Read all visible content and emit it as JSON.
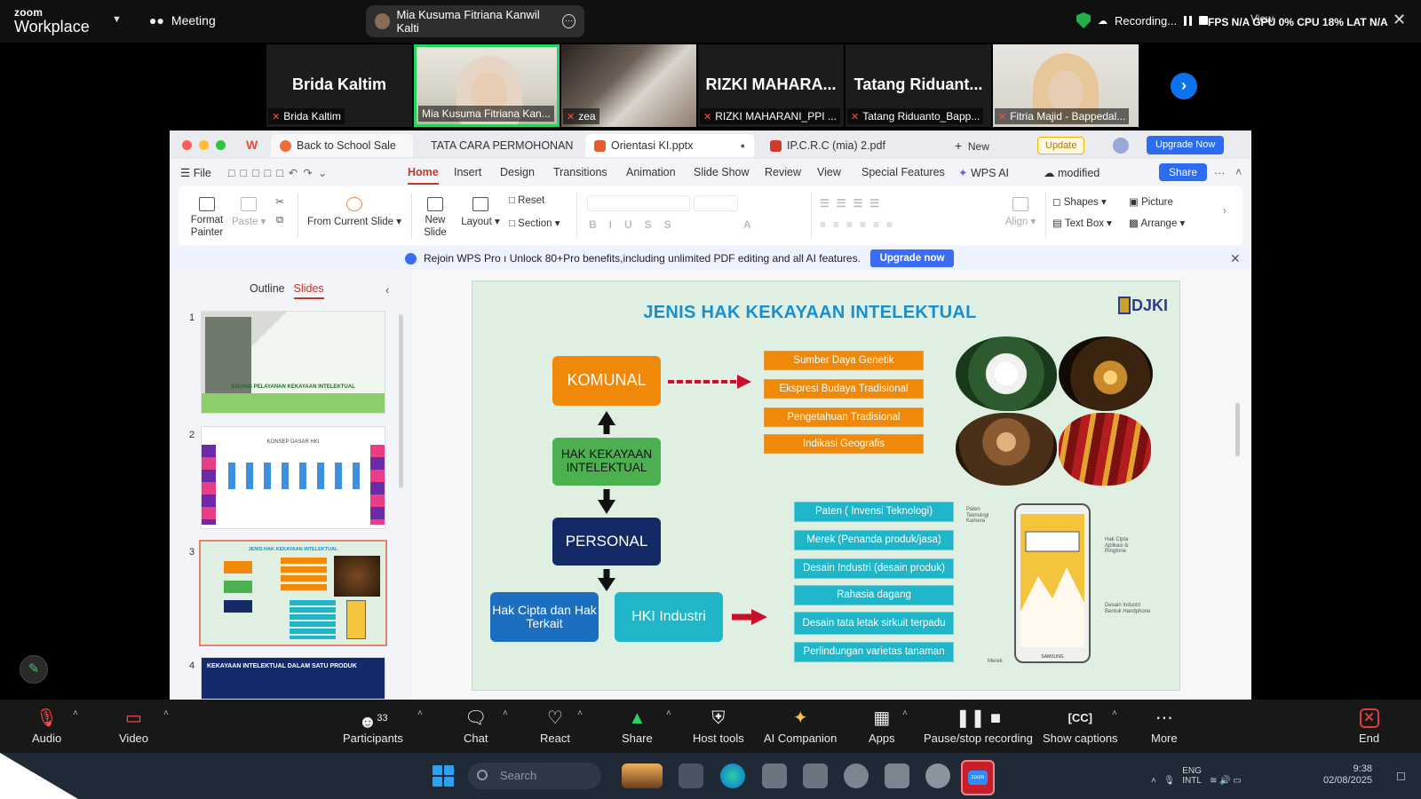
{
  "zoom": {
    "brand_small": "zoom",
    "brand_large": "Workplace",
    "meeting_label": "Meeting",
    "active_speaker": "Mia Kusuma Fitriana Kanwil Kalti",
    "recording_label": "Recording...",
    "stats": "FPS N/A GPU 0% CPU 18% LAT N/A",
    "view_label": "View",
    "participants": [
      {
        "display": "Brida Kaltim",
        "label": "Brida Kaltim"
      },
      {
        "display": "",
        "label": "Mia Kusuma Fitriana Kan..."
      },
      {
        "display": "",
        "label": "zea"
      },
      {
        "display": "RIZKI MAHARA...",
        "label": "RIZKI MAHARANI_PPI ..."
      },
      {
        "display": "Tatang Riduant...",
        "label": "Tatang Riduanto_Bapp..."
      },
      {
        "display": "",
        "label": "Fitria Majid - Bappedal..."
      }
    ]
  },
  "wps": {
    "tabs": [
      "Back to School Sale",
      "TATA CARA PERMOHONAN",
      "Orientasi KI.pptx",
      "IP.C.R.C (mia) 2.pdf"
    ],
    "new_tab": "New",
    "update": "Update",
    "upgrade_now": "Upgrade Now",
    "menu": [
      "File",
      "Home",
      "Insert",
      "Design",
      "Transitions",
      "Animation",
      "Slide Show",
      "Review",
      "View",
      "Special Features",
      "WPS AI"
    ],
    "modified": "modified",
    "share": "Share",
    "ribbon": {
      "format_painter": "Format Painter",
      "paste": "Paste",
      "from_current_slide": "From Current Slide",
      "new_slide": "New Slide",
      "layout": "Layout",
      "reset": "Reset",
      "section": "Section",
      "align": "Align",
      "shapes": "Shapes",
      "picture": "Picture",
      "text_box": "Text Box",
      "arrange": "Arrange"
    },
    "banner_text": "Rejoin WPS Pro ı Unlock 80+Pro benefits,including unlimited PDF editing and all AI features.",
    "banner_button": "Upgrade now",
    "sidebar_tabs": [
      "Outline",
      "Slides"
    ],
    "slide_numbers": [
      "1",
      "2",
      "3",
      "4"
    ],
    "thumb1_title": "BIDANG PELAYANAN KEKAYAAN INTELEKTUAL",
    "thumb2_title": "KONSEP DASAR HKI",
    "thumb3_title": "JENIS HAK KEKAYAAN INTELEKTUAL",
    "thumb4_title": "KEKAYAAN INTELEKTUAL DALAM SATU PRODUK"
  },
  "slide": {
    "title": "JENIS HAK KEKAYAAN INTELEKTUAL",
    "logo_text": "DJKI",
    "komunal": "KOMUNAL",
    "hki": "HAK KEKAYAAN INTELEKTUAL",
    "personal": "PERSONAL",
    "hak_cipta": "Hak Cipta dan Hak Terkait",
    "hki_industri": "HKI Industri",
    "komunal_items": [
      "Sumber Daya Genetik",
      "Ekspresi Budaya Tradisional",
      "Pengetahuan Tradisional",
      "Indikasi Geografis"
    ],
    "industri_items": [
      "Paten ( Invensi Teknologi)",
      "Merek (Penanda produk/jasa)",
      "Desain Industri (desain produk)",
      "Rahasia dagang",
      "Desain tata letak sirkuit terpadu",
      "Perlindungan varietas tanaman"
    ],
    "phone_notes": [
      "Paten Teknologi Kamera",
      "Hak Cipta Aplikasi & Ringtone",
      "Desain Industri Bentuk Handphone",
      "Merek",
      "SAMSUNG"
    ]
  },
  "toolbar": {
    "audio": "Audio",
    "video": "Video",
    "participants": "Participants",
    "participants_count": "33",
    "chat": "Chat",
    "react": "React",
    "share": "Share",
    "host_tools": "Host tools",
    "ai_companion": "AI Companion",
    "apps": "Apps",
    "pause_stop": "Pause/stop recording",
    "captions": "Show captions",
    "more": "More",
    "end": "End"
  },
  "taskbar": {
    "search_placeholder": "Search",
    "lang": "ENG INTL",
    "time": "9:38",
    "date": "02/08/2025"
  },
  "colors": {
    "accent_blue": "#0e72ed",
    "wps_red": "#c0392b",
    "komunal_orange": "#f0880a",
    "hki_green": "#4caf50",
    "personal_navy": "#132a66",
    "teal": "#1fb6c9"
  }
}
